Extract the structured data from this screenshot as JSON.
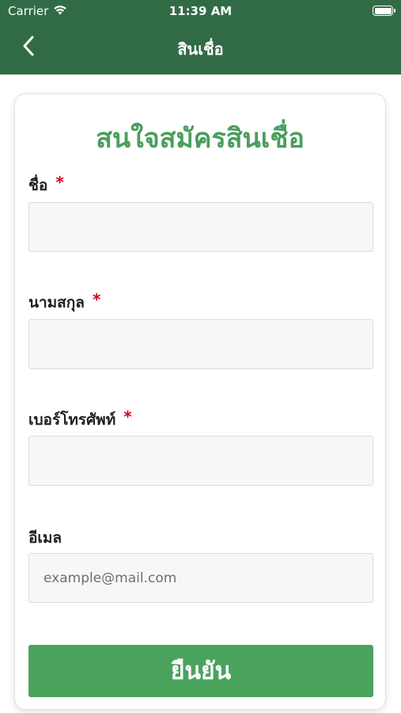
{
  "status_bar": {
    "carrier": "Carrier",
    "time": "11:39 AM"
  },
  "nav": {
    "title": "สินเชื่อ",
    "back_icon": "chevron-left-icon"
  },
  "form": {
    "title": "สนใจสมัครสินเชื่อ",
    "required_mark": "*",
    "fields": [
      {
        "label": "ชื่อ",
        "required": true,
        "value": "",
        "placeholder": ""
      },
      {
        "label": "นามสกุล",
        "required": true,
        "value": "",
        "placeholder": ""
      },
      {
        "label": "เบอร์โทรศัพท์",
        "required": true,
        "value": "",
        "placeholder": ""
      },
      {
        "label": "อีเมล",
        "required": false,
        "value": "",
        "placeholder": "example@mail.com"
      }
    ],
    "submit_label": "ยืนยัน"
  },
  "colors": {
    "header_bg": "#316b45",
    "title_green": "#4a9e5c",
    "button_green": "#4aa35d",
    "required_red": "#d0021b"
  }
}
